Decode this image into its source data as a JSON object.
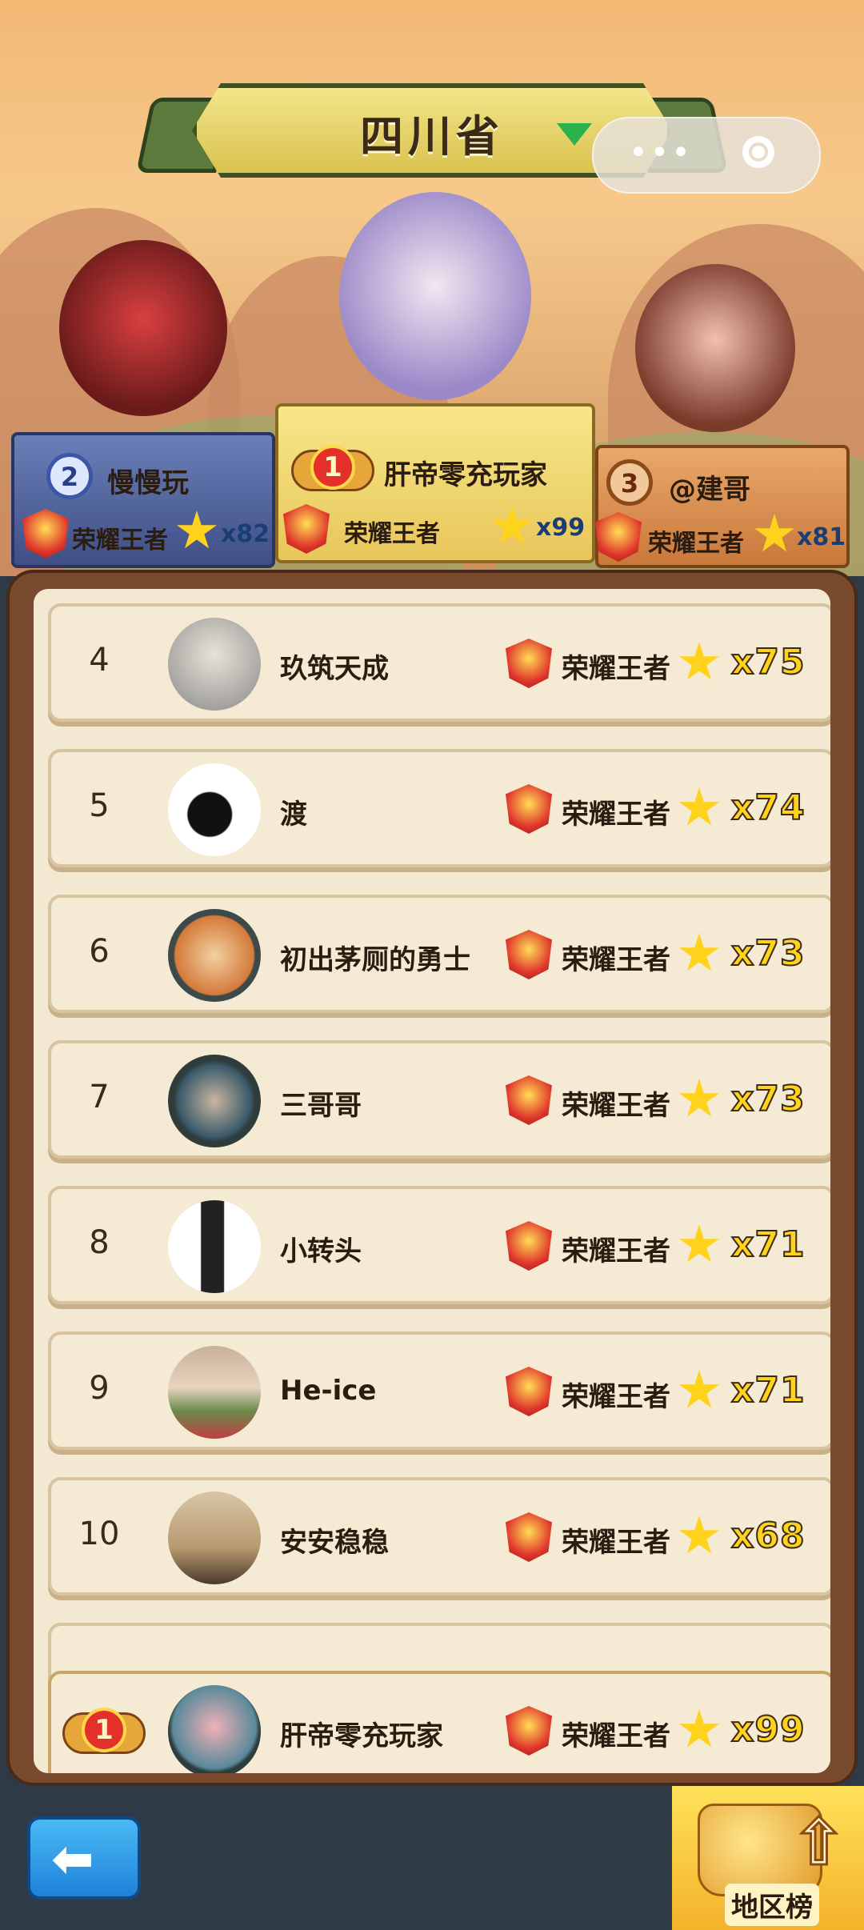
{
  "header": {
    "province": "四川省"
  },
  "podium": [
    {
      "rank": "2",
      "name": "慢慢玩",
      "title": "荣耀王者",
      "stars": "x82"
    },
    {
      "rank": "1",
      "name": "肝帝零充玩家",
      "title": "荣耀王者",
      "stars": "x99"
    },
    {
      "rank": "3",
      "name": "@建哥",
      "title": "荣耀王者",
      "stars": "x81"
    }
  ],
  "list": [
    {
      "rank": "4",
      "name": "玖筑天成",
      "title": "荣耀王者",
      "stars": "x75"
    },
    {
      "rank": "5",
      "name": "渡",
      "title": "荣耀王者",
      "stars": "x74"
    },
    {
      "rank": "6",
      "name": "初出茅厕的勇士",
      "title": "荣耀王者",
      "stars": "x73"
    },
    {
      "rank": "7",
      "name": "三哥哥",
      "title": "荣耀王者",
      "stars": "x73"
    },
    {
      "rank": "8",
      "name": "小转头",
      "title": "荣耀王者",
      "stars": "x71"
    },
    {
      "rank": "9",
      "name": "He-ice",
      "title": "荣耀王者",
      "stars": "x71"
    },
    {
      "rank": "10",
      "name": "安安稳稳",
      "title": "荣耀王者",
      "stars": "x68"
    }
  ],
  "my_rank": {
    "rank": "1",
    "name": "肝帝零充玩家",
    "title": "荣耀王者",
    "stars": "x99"
  },
  "bottom": {
    "region_label": "地区榜"
  },
  "colors": {
    "gold": "#ffd21c",
    "frame_brown": "#7a4a2e",
    "row_bg": "#f5ead3"
  }
}
